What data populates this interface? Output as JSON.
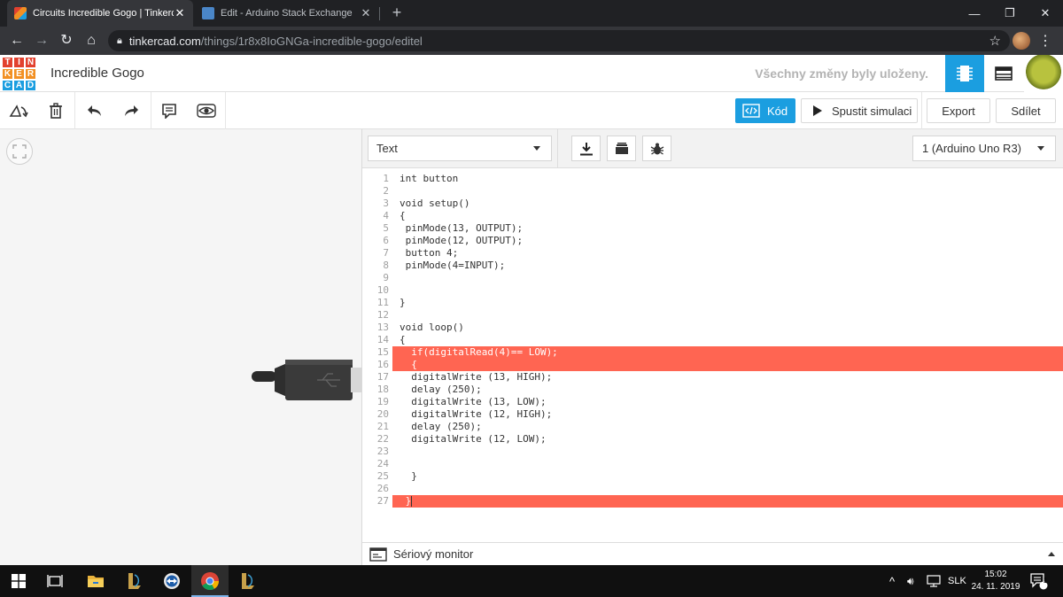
{
  "browser": {
    "tabs": [
      {
        "title": "Circuits Incredible Gogo | Tinkercad",
        "active": true
      },
      {
        "title": "Edit - Arduino Stack Exchange",
        "active": false
      }
    ],
    "url_host": "tinkercad.com",
    "url_path": "/things/1r8x8IoGNGa-incredible-gogo/editel"
  },
  "header": {
    "logo_letters": [
      "T",
      "I",
      "N",
      "K",
      "E",
      "R",
      "C",
      "A",
      "D"
    ],
    "logo_colors": [
      "#e2412f",
      "#e2412f",
      "#e2412f",
      "#f29023",
      "#f29023",
      "#f29023",
      "#1b9ee0",
      "#1b9ee0",
      "#1b9ee0"
    ],
    "design_title": "Incredible Gogo",
    "save_status": "Všechny změny byly uloženy."
  },
  "toolbar": {
    "code_label": "Kód",
    "simulate_label": "Spustit simulaci",
    "export_label": "Export",
    "share_label": "Sdílet"
  },
  "code_panel": {
    "mode": "Text",
    "device": "1 (Arduino Uno R3)",
    "serial_monitor_label": "Sériový monitor",
    "lines": [
      {
        "n": "1",
        "text": "int button"
      },
      {
        "n": "2",
        "text": ""
      },
      {
        "n": "3",
        "text": "void setup()"
      },
      {
        "n": "4",
        "text": "{"
      },
      {
        "n": "5",
        "text": " pinMode(13, OUTPUT);"
      },
      {
        "n": "6",
        "text": " pinMode(12, OUTPUT);"
      },
      {
        "n": "7",
        "text": " button 4;"
      },
      {
        "n": "8",
        "text": " pinMode(4=INPUT);"
      },
      {
        "n": "9",
        "text": ""
      },
      {
        "n": "10",
        "text": ""
      },
      {
        "n": "11",
        "text": "}"
      },
      {
        "n": "12",
        "text": ""
      },
      {
        "n": "13",
        "text": "void loop()"
      },
      {
        "n": "14",
        "text": "{"
      },
      {
        "n": "15",
        "text": "  if(digitalRead(4)== LOW);",
        "error": true
      },
      {
        "n": "16",
        "text": "  {",
        "error": true
      },
      {
        "n": "17",
        "text": "  digitalWrite (13, HIGH);"
      },
      {
        "n": "18",
        "text": "  delay (250);"
      },
      {
        "n": "19",
        "text": "  digitalWrite (13, LOW);"
      },
      {
        "n": "20",
        "text": "  digitalWrite (12, HIGH);"
      },
      {
        "n": "21",
        "text": "  delay (250);"
      },
      {
        "n": "22",
        "text": "  digitalWrite (12, LOW);"
      },
      {
        "n": "23",
        "text": ""
      },
      {
        "n": "24",
        "text": ""
      },
      {
        "n": "25",
        "text": "  }"
      },
      {
        "n": "26",
        "text": ""
      },
      {
        "n": "27",
        "text": " }",
        "error": true,
        "cursor": true
      }
    ]
  },
  "taskbar": {
    "language": "SLK",
    "time": "15:02",
    "date": "24. 11. 2019",
    "notification_count": "1"
  },
  "colors": {
    "accent": "#1b9ee0",
    "error_highlight": "#ff6552"
  }
}
